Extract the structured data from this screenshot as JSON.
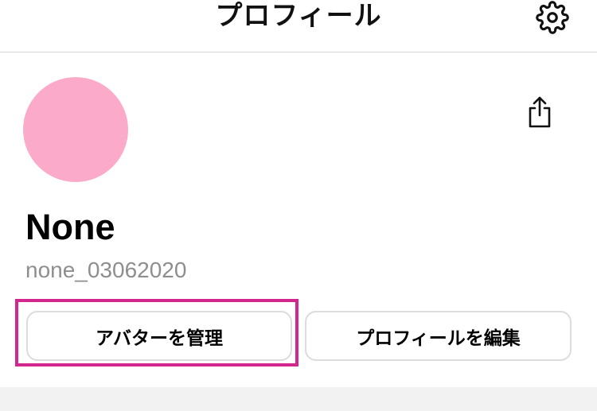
{
  "header": {
    "title": "プロフィール",
    "settings_icon": "gear-icon"
  },
  "profile": {
    "avatar_color": "#fbabc9",
    "share_icon": "share-icon",
    "display_name": "None",
    "username": "none_03062020"
  },
  "actions": {
    "manage_avatar_label": "アバターを管理",
    "edit_profile_label": "プロフィールを編集",
    "highlight_color": "#d4268f"
  }
}
